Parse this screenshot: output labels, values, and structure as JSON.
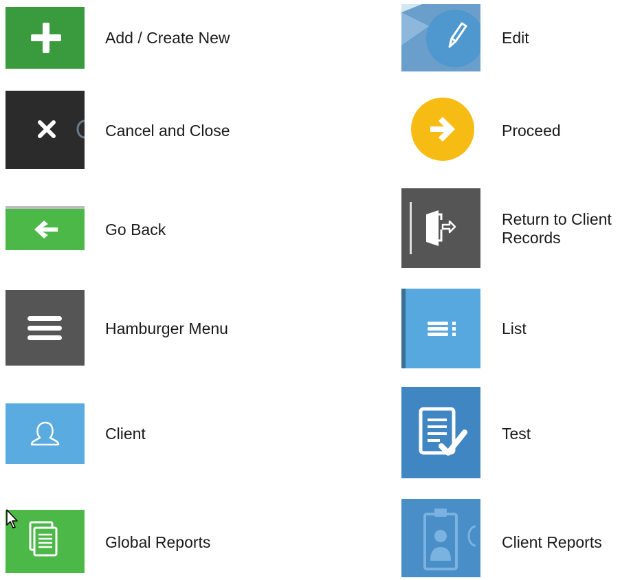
{
  "legend": {
    "left": [
      {
        "id": "add",
        "label": "Add / Create New",
        "icon": "plus-icon",
        "color": "#3a9a3e"
      },
      {
        "id": "cancel",
        "label": "Cancel and Close",
        "icon": "close-icon",
        "color": "#2b2b2b"
      },
      {
        "id": "back",
        "label": "Go Back",
        "icon": "arrow-left-icon",
        "color": "#4cb848"
      },
      {
        "id": "hamburger",
        "label": "Hamburger Menu",
        "icon": "hamburger-menu-icon",
        "color": "#555555"
      },
      {
        "id": "client",
        "label": "Client",
        "icon": "user-outline-icon",
        "color": "#5aabe0"
      },
      {
        "id": "global-reports",
        "label": "Global Reports",
        "icon": "document-stack-icon",
        "color": "#4cb848"
      }
    ],
    "right": [
      {
        "id": "edit",
        "label": "Edit",
        "icon": "pencil-icon",
        "color": "#4f97cf"
      },
      {
        "id": "proceed",
        "label": "Proceed",
        "icon": "arrow-right-circle-icon",
        "color": "#f7bc14"
      },
      {
        "id": "return",
        "label_line1": "Return to Client",
        "label_line2": "Records",
        "icon": "door-exit-icon",
        "color": "#555555"
      },
      {
        "id": "list",
        "label": "List",
        "icon": "list-icon",
        "color": "#58a8e0"
      },
      {
        "id": "test",
        "label": "Test",
        "icon": "checklist-icon",
        "color": "#3f86c2"
      },
      {
        "id": "client-reports",
        "label": "Client Reports",
        "icon": "clipboard-user-icon",
        "color": "#4a8ec8"
      }
    ]
  }
}
